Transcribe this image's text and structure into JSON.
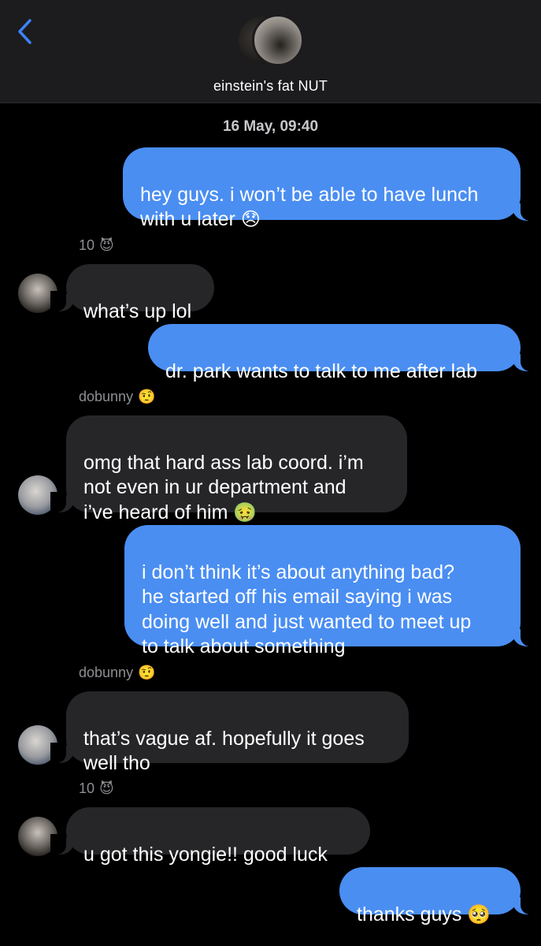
{
  "header": {
    "back_icon": "chevron-left-icon",
    "title": "einstein's fat NUT"
  },
  "timestamp": "16 May, 09:40",
  "messages": [
    {
      "direction": "outgoing",
      "text": "hey guys. i won’t be able to have lunch\nwith u later",
      "emoji": "😞"
    },
    {
      "direction": "incoming",
      "sender": "10",
      "sender_emoji": "😈",
      "text": "what’s up lol"
    },
    {
      "direction": "outgoing",
      "text": "dr. park wants to talk to me after lab"
    },
    {
      "direction": "incoming",
      "sender": "dobunny",
      "sender_emoji": "🤨",
      "text": "omg that hard ass lab coord. i’m\nnot even in ur department and\ni’ve heard of him",
      "emoji": "🤢"
    },
    {
      "direction": "outgoing",
      "text": "i don’t think it’s about anything bad?\nhe started off his email saying i was\ndoing well and just wanted to meet up\nto talk about something"
    },
    {
      "direction": "incoming",
      "sender": "dobunny",
      "sender_emoji": "🤨",
      "text": "that’s vague af. hopefully it goes\nwell tho"
    },
    {
      "direction": "incoming",
      "sender": "10",
      "sender_emoji": "😈",
      "text": "u got this yongie!! good luck"
    },
    {
      "direction": "outgoing",
      "text": "thanks guys",
      "emoji": "🥺"
    }
  ],
  "colors": {
    "outgoing_bubble": "#4a8ef2",
    "incoming_bubble": "#262628",
    "background": "#000000",
    "header": "#1c1c1e",
    "back_icon": "#3b82f6"
  }
}
